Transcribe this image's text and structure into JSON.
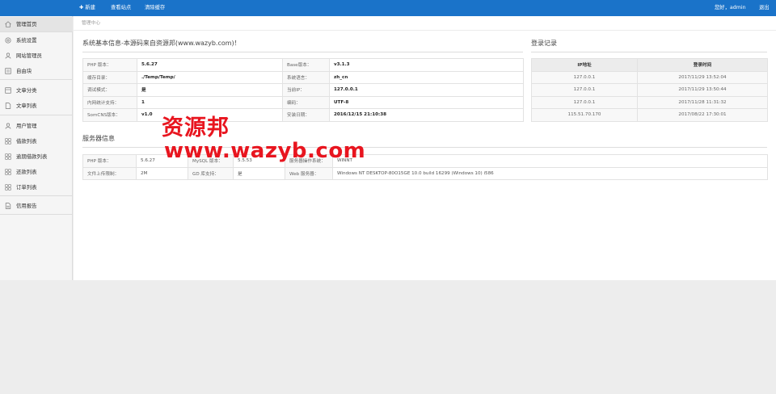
{
  "topbar": {
    "new_label": "✚ 新建",
    "view_site": "查看站点",
    "clear_cache": "清除缓存",
    "greeting": "您好，admin",
    "logout": "退出"
  },
  "sidebar": {
    "items": [
      {
        "label": "管理首页",
        "icon": "home-icon"
      },
      {
        "label": "系统设置",
        "icon": "gear-icon"
      },
      {
        "label": "网站管理员",
        "icon": "user-icon"
      },
      {
        "label": "自由块",
        "icon": "block-icon"
      },
      {
        "label": "文章分类",
        "icon": "category-icon"
      },
      {
        "label": "文章列表",
        "icon": "document-icon"
      },
      {
        "label": "用户管理",
        "icon": "user-icon"
      },
      {
        "label": "借款列表",
        "icon": "grid-icon"
      },
      {
        "label": "逾期借款列表",
        "icon": "grid-icon"
      },
      {
        "label": "还款列表",
        "icon": "grid-icon"
      },
      {
        "label": "订单列表",
        "icon": "grid-icon"
      },
      {
        "label": "信用报告",
        "icon": "report-icon"
      }
    ]
  },
  "breadcrumb": "管理中心",
  "sysinfo": {
    "title": "系统基本信息-本源码来自资源邦(www.wazyb.com)！",
    "rows": [
      [
        "PHP 版本：",
        "5.6.27",
        "Base版本：",
        "v3.1.3"
      ],
      [
        "缓存目录：",
        "./Temp/Temp/",
        "系统语言：",
        "zh_cn"
      ],
      [
        "调试模式：",
        "是",
        "当前IP：",
        "127.0.0.1"
      ],
      [
        "内网统计支持：",
        "1",
        "编码：",
        "UTF-8"
      ],
      [
        "SomCNS版本：",
        "v1.0",
        "安装日期：",
        "2016/12/15 21:10:38"
      ]
    ]
  },
  "login": {
    "title": "登录记录",
    "headers": [
      "IP地址",
      "登录时间"
    ],
    "rows": [
      [
        "127.0.0.1",
        "2017/11/29 13:52:04"
      ],
      [
        "127.0.0.1",
        "2017/11/29 13:50:44"
      ],
      [
        "127.0.0.1",
        "2017/11/28 11:31:32"
      ],
      [
        "115.51.70.170",
        "2017/08/22 17:30:01"
      ]
    ]
  },
  "server": {
    "title": "服务器信息",
    "rows": [
      [
        "PHP 版本：",
        "5.6.27",
        "MySQL 版本：",
        "5.5.53",
        "服务器操作系统：",
        "WINNT"
      ],
      [
        "文件上传限制：",
        "2M",
        "GD 库支持：",
        "是",
        "Web 服务器：",
        "Windows NT DESKTOP-80O15GE 10.0 build 16299 (Windows 10) i586"
      ]
    ]
  },
  "watermark": {
    "line1": "资源邦",
    "line2": "www.wazyb.com",
    "color": "#e8151f"
  },
  "colors": {
    "topbar": "#1a73c9"
  }
}
